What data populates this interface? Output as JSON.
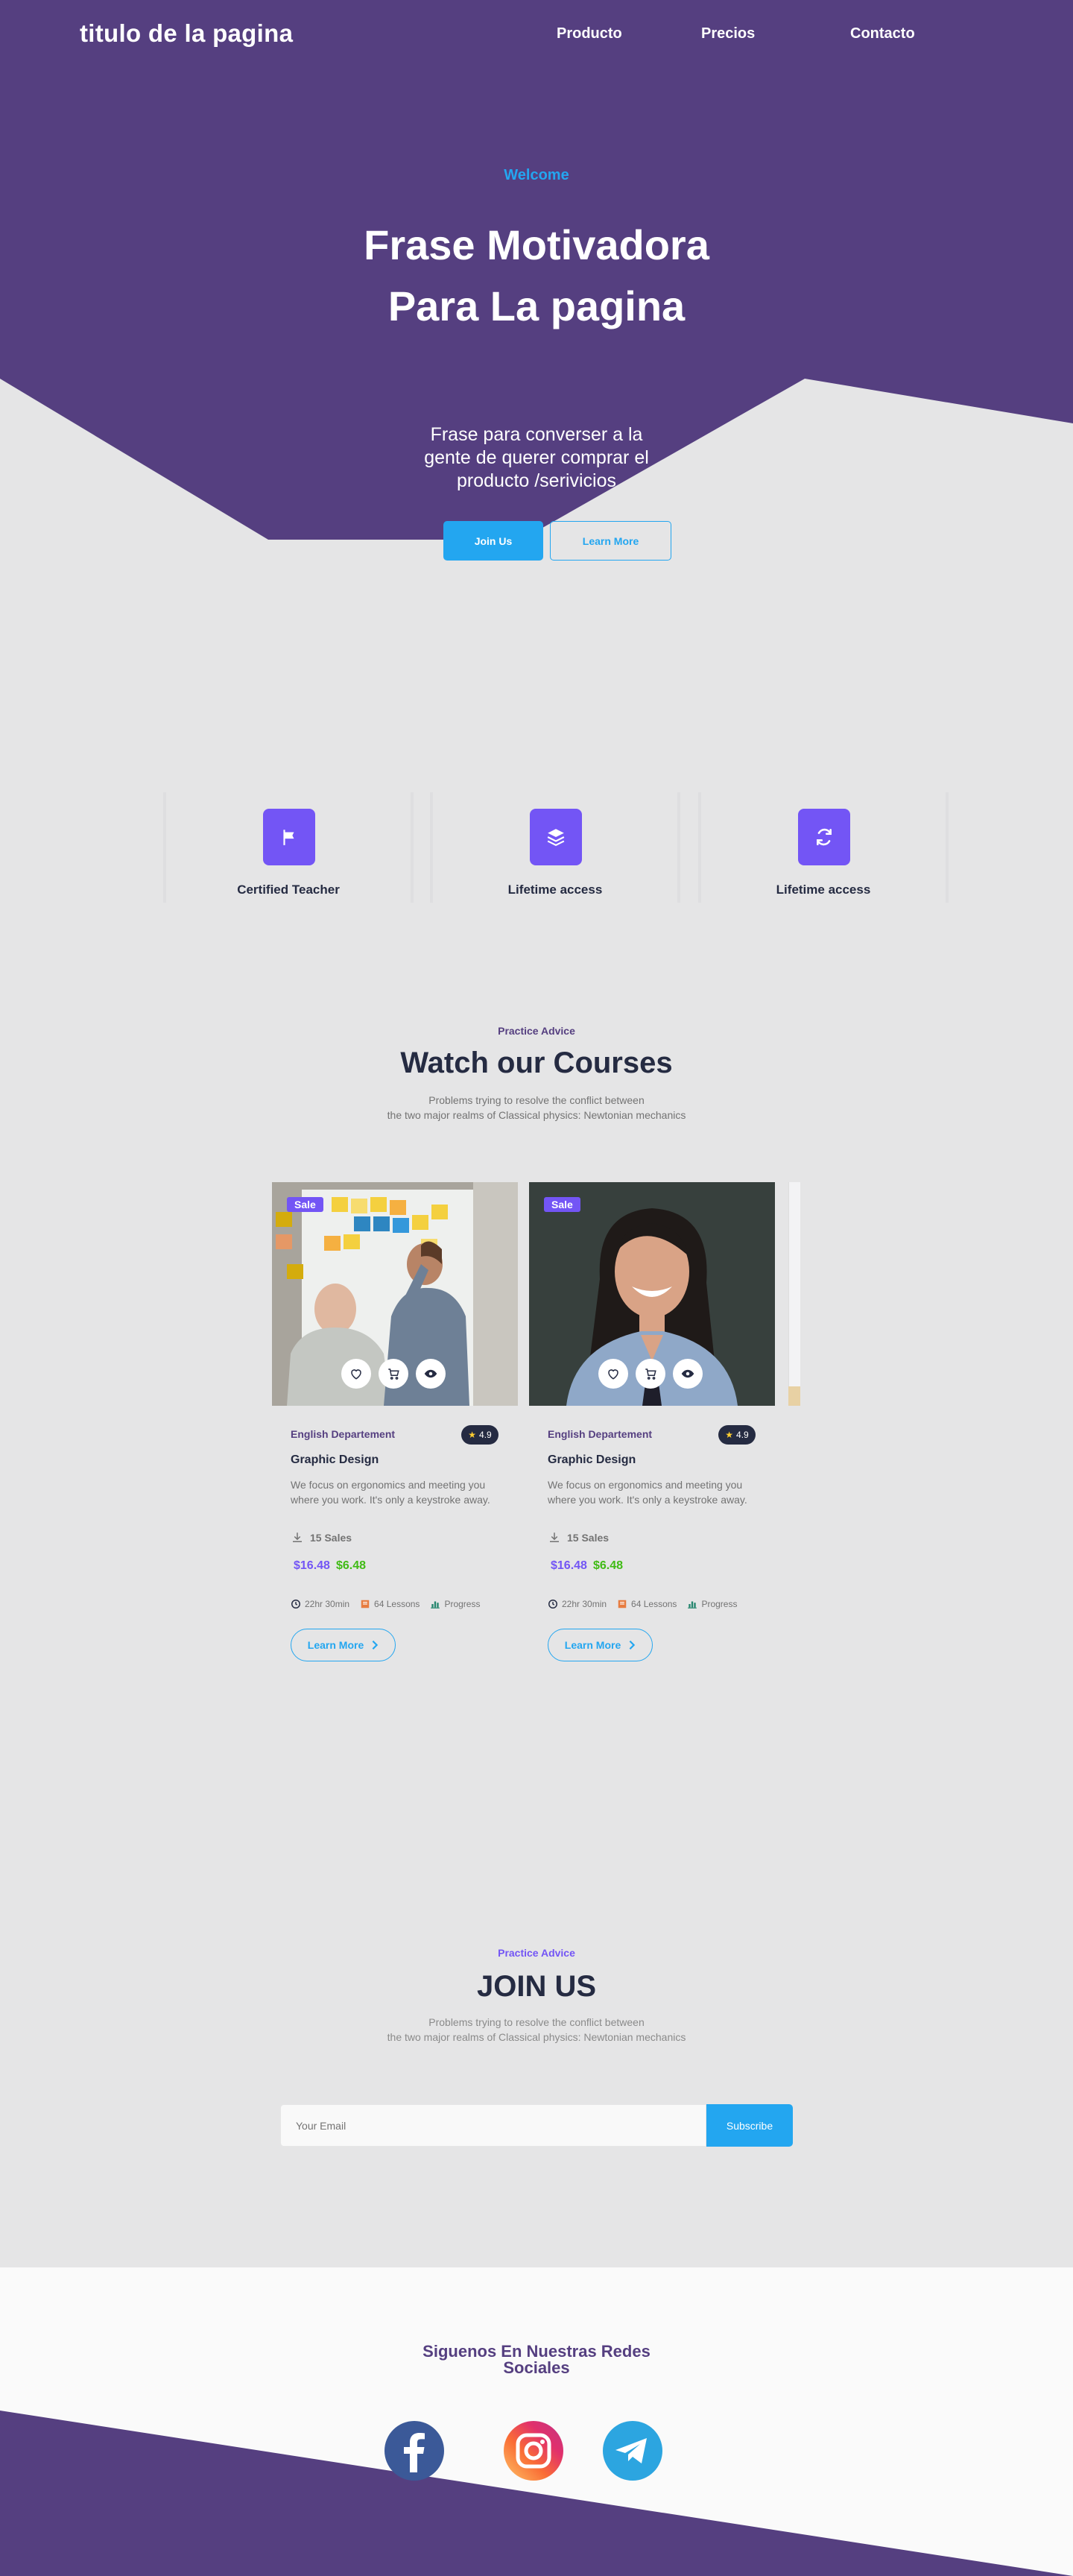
{
  "nav": {
    "title": "titulo de la pagina",
    "links": [
      "Producto",
      "Precios",
      "Contacto"
    ]
  },
  "hero": {
    "welcome": "Welcome",
    "title_line1": "Frase Motivadora",
    "title_line2": "Para La pagina",
    "subtitle": "Frase para converser a la gente de querer comprar el producto /serivicios",
    "join_button": "Join Us",
    "learn_button": "Learn More"
  },
  "features": [
    {
      "label": "Certified Teacher",
      "icon": "flag-icon"
    },
    {
      "label": "Lifetime access",
      "icon": "layers-icon"
    },
    {
      "label": "Lifetime access",
      "icon": "refresh-icon"
    }
  ],
  "courses": {
    "kicker": "Practice Advice",
    "title": "Watch our Courses",
    "text_line1": "Problems trying to resolve the conflict between",
    "text_line2": "the two major realms of Classical physics: Newtonian mechanics",
    "cards": [
      {
        "badge": "Sale",
        "department": "English Departement",
        "rating": "4.9",
        "title": "Graphic Design",
        "description": "We focus on ergonomics and meeting you where you work. It's only a keystroke away.",
        "sales": "15 Sales",
        "old_price": "$16.48",
        "new_price": "$6.48",
        "duration": "22hr 30min",
        "lessons": "64 Lessons",
        "progress": "Progress",
        "button": "Learn More"
      },
      {
        "badge": "Sale",
        "department": "English Departement",
        "rating": "4.9",
        "title": "Graphic Design",
        "description": "We focus on ergonomics and meeting you where you work. It's only a keystroke away.",
        "sales": "15 Sales",
        "old_price": "$16.48",
        "new_price": "$6.48",
        "duration": "22hr 30min",
        "lessons": "64 Lessons",
        "progress": "Progress",
        "button": "Learn More"
      }
    ]
  },
  "join": {
    "kicker": "Practice Advice",
    "title": "JOIN US",
    "text_line1": "Problems trying to resolve the conflict between",
    "text_line2": "the two major realms of Classical physics: Newtonian mechanics",
    "email_placeholder": "Your Email",
    "subscribe": "Subscribe"
  },
  "footer": {
    "follow_line1": "Siguenos En Nuestras Redes",
    "follow_line2": "Sociales",
    "socials": [
      "facebook-icon",
      "instagram-icon",
      "telegram-icon"
    ]
  },
  "colors": {
    "primary_purple": "#553f80",
    "accent_blue": "#23a6f0",
    "icon_purple": "#7355f5",
    "price_green": "#40bb15",
    "dark_text": "#252b42",
    "page_bg": "#e5e5e6"
  }
}
